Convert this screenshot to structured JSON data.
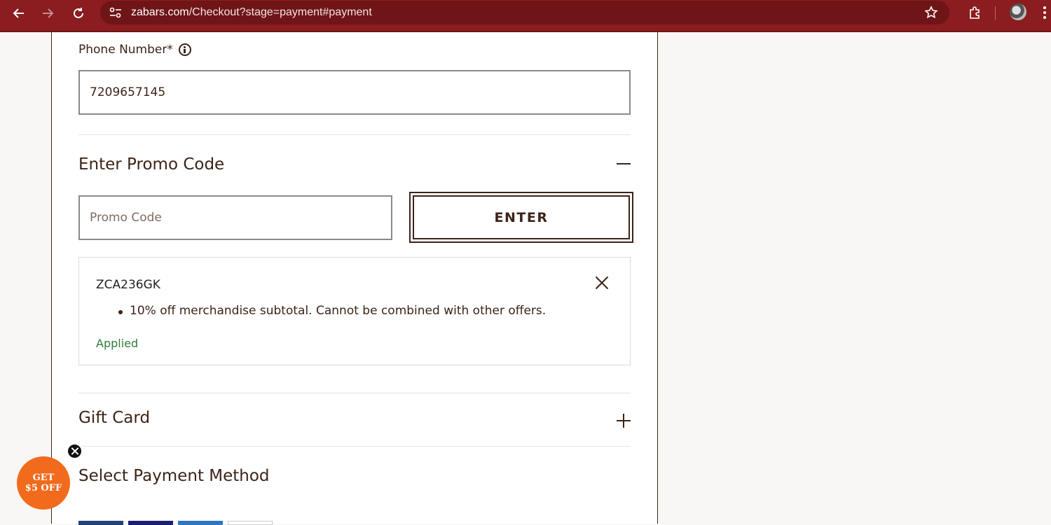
{
  "browser": {
    "url_host": "zabars.com",
    "url_path": "/Checkout?stage=payment#payment",
    "chrome_color": "#8b1c1f"
  },
  "phone": {
    "label": "Phone Number*",
    "value": "7209657145"
  },
  "promo_section": {
    "title": "Enter Promo Code",
    "input_placeholder": "Promo Code",
    "input_value": "",
    "enter_label": "ENTER",
    "applied_code": {
      "code": "ZCA236GK",
      "description": "10% off merchandise subtotal. Cannot be combined with other offers.",
      "status": "Applied",
      "status_color": "#2e7d32"
    }
  },
  "gift_card": {
    "title": "Gift Card"
  },
  "payment_method": {
    "title": "Select Payment Method",
    "card_logo_colors": [
      "#24407a",
      "#1a1f71",
      "#2f74c0",
      "#ffffff"
    ]
  },
  "offer_bubble": {
    "line1": "GET",
    "line2": "$5 OFF",
    "color": "#f26b1d"
  }
}
